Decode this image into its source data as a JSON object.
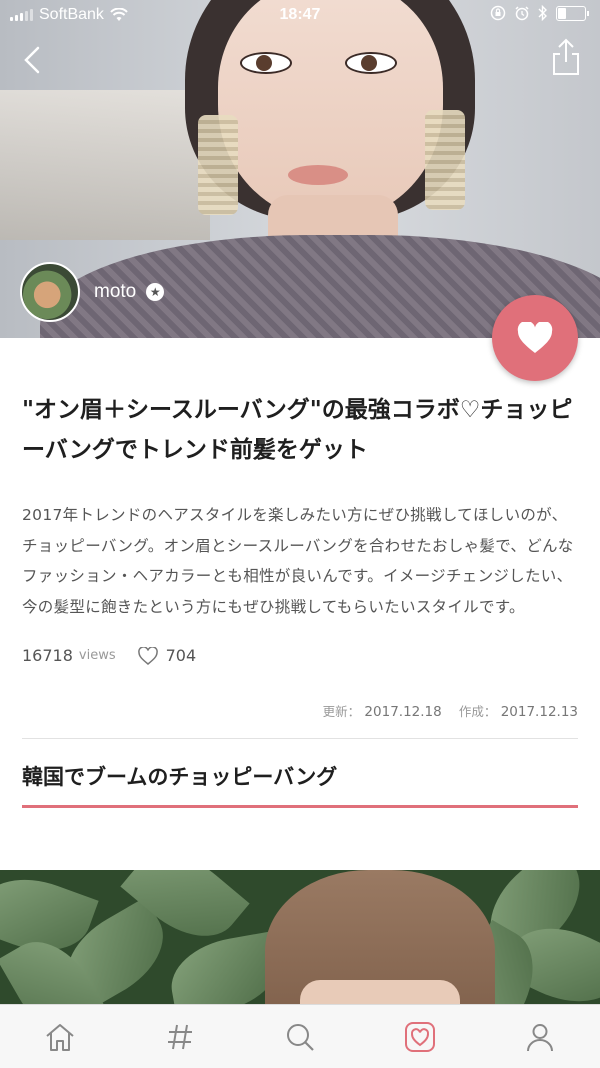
{
  "status_bar": {
    "carrier": "SoftBank",
    "time": "18:47"
  },
  "author": {
    "name": "moto"
  },
  "article": {
    "title": "\"オン眉＋シースルーバング\"の最強コラボ♡チョッピーバングでトレンド前髪をゲット",
    "lead": "2017年トレンドのヘアスタイルを楽しみたい方にぜひ挑戦してほしいのが、チョッピーバング。オン眉とシースルーバングを合わせたおしゃ髪で、どんなファッション・ヘアカラーとも相性が良いんです。イメージチェンジしたい、今の髪型に飽きたという方にもぜひ挑戦してもらいたいスタイルです。",
    "views": "16718",
    "views_unit": "views",
    "likes": "704",
    "updated_label": "更新：",
    "updated_date": "2017.12.18",
    "created_label": "作成：",
    "created_date": "2017.12.13",
    "section_title": "韓国でブームのチョッピーバング"
  },
  "tab_bar": {
    "tabs": [
      "home-icon",
      "hashtag-icon",
      "search-icon",
      "favorites-icon",
      "profile-icon"
    ],
    "active": "favorites-icon"
  },
  "colors": {
    "accent": "#e0707a"
  }
}
